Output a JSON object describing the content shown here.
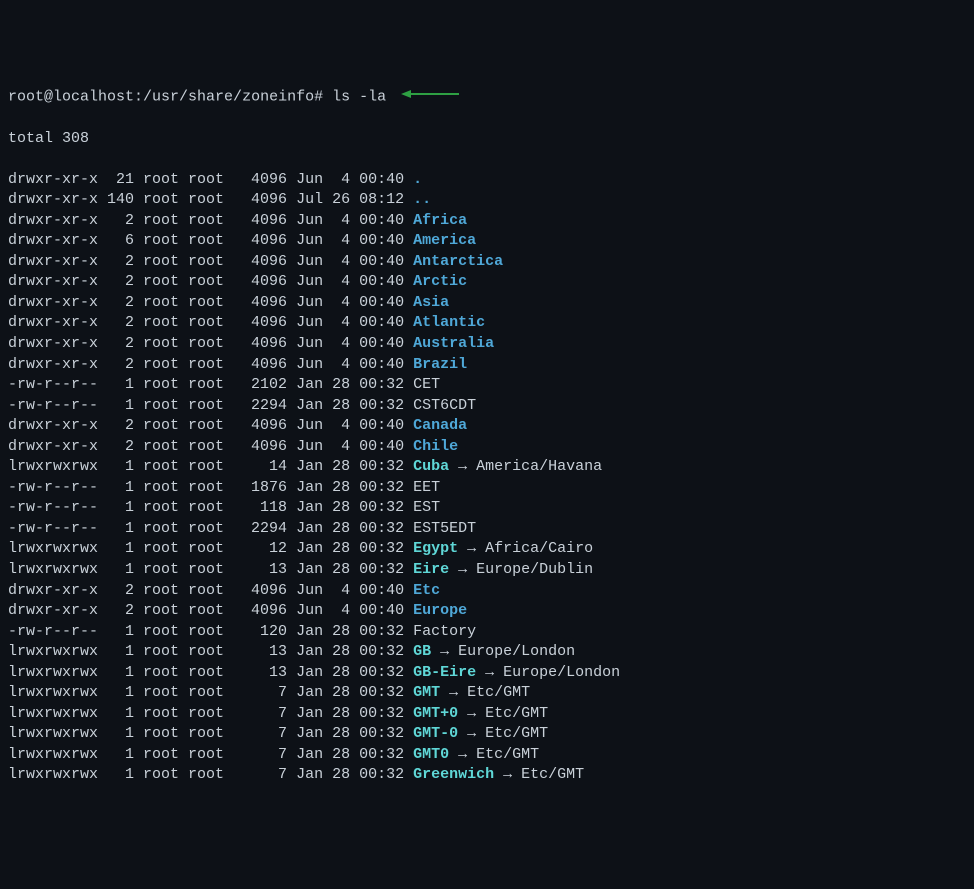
{
  "prompt": {
    "user_host": "root@localhost",
    "path": "/usr/share/zoneinfo",
    "sep": "#",
    "command": "ls -la"
  },
  "total_line": "total 308",
  "entries": [
    {
      "perms": "drwxr-xr-x",
      "links": "21",
      "owner": "root",
      "group": "root",
      "size": "4096",
      "date": "Jun  4 00:40",
      "name": ".",
      "type": "dir"
    },
    {
      "perms": "drwxr-xr-x",
      "links": "140",
      "owner": "root",
      "group": "root",
      "size": "4096",
      "date": "Jul 26 08:12",
      "name": "..",
      "type": "dir"
    },
    {
      "perms": "drwxr-xr-x",
      "links": "2",
      "owner": "root",
      "group": "root",
      "size": "4096",
      "date": "Jun  4 00:40",
      "name": "Africa",
      "type": "dir"
    },
    {
      "perms": "drwxr-xr-x",
      "links": "6",
      "owner": "root",
      "group": "root",
      "size": "4096",
      "date": "Jun  4 00:40",
      "name": "America",
      "type": "dir"
    },
    {
      "perms": "drwxr-xr-x",
      "links": "2",
      "owner": "root",
      "group": "root",
      "size": "4096",
      "date": "Jun  4 00:40",
      "name": "Antarctica",
      "type": "dir"
    },
    {
      "perms": "drwxr-xr-x",
      "links": "2",
      "owner": "root",
      "group": "root",
      "size": "4096",
      "date": "Jun  4 00:40",
      "name": "Arctic",
      "type": "dir"
    },
    {
      "perms": "drwxr-xr-x",
      "links": "2",
      "owner": "root",
      "group": "root",
      "size": "4096",
      "date": "Jun  4 00:40",
      "name": "Asia",
      "type": "dir"
    },
    {
      "perms": "drwxr-xr-x",
      "links": "2",
      "owner": "root",
      "group": "root",
      "size": "4096",
      "date": "Jun  4 00:40",
      "name": "Atlantic",
      "type": "dir"
    },
    {
      "perms": "drwxr-xr-x",
      "links": "2",
      "owner": "root",
      "group": "root",
      "size": "4096",
      "date": "Jun  4 00:40",
      "name": "Australia",
      "type": "dir"
    },
    {
      "perms": "drwxr-xr-x",
      "links": "2",
      "owner": "root",
      "group": "root",
      "size": "4096",
      "date": "Jun  4 00:40",
      "name": "Brazil",
      "type": "dir"
    },
    {
      "perms": "-rw-r--r--",
      "links": "1",
      "owner": "root",
      "group": "root",
      "size": "2102",
      "date": "Jan 28 00:32",
      "name": "CET",
      "type": "file"
    },
    {
      "perms": "-rw-r--r--",
      "links": "1",
      "owner": "root",
      "group": "root",
      "size": "2294",
      "date": "Jan 28 00:32",
      "name": "CST6CDT",
      "type": "file"
    },
    {
      "perms": "drwxr-xr-x",
      "links": "2",
      "owner": "root",
      "group": "root",
      "size": "4096",
      "date": "Jun  4 00:40",
      "name": "Canada",
      "type": "dir"
    },
    {
      "perms": "drwxr-xr-x",
      "links": "2",
      "owner": "root",
      "group": "root",
      "size": "4096",
      "date": "Jun  4 00:40",
      "name": "Chile",
      "type": "dir"
    },
    {
      "perms": "lrwxrwxrwx",
      "links": "1",
      "owner": "root",
      "group": "root",
      "size": "14",
      "date": "Jan 28 00:32",
      "name": "Cuba",
      "type": "link",
      "target": "America/Havana"
    },
    {
      "perms": "-rw-r--r--",
      "links": "1",
      "owner": "root",
      "group": "root",
      "size": "1876",
      "date": "Jan 28 00:32",
      "name": "EET",
      "type": "file"
    },
    {
      "perms": "-rw-r--r--",
      "links": "1",
      "owner": "root",
      "group": "root",
      "size": "118",
      "date": "Jan 28 00:32",
      "name": "EST",
      "type": "file"
    },
    {
      "perms": "-rw-r--r--",
      "links": "1",
      "owner": "root",
      "group": "root",
      "size": "2294",
      "date": "Jan 28 00:32",
      "name": "EST5EDT",
      "type": "file"
    },
    {
      "perms": "lrwxrwxrwx",
      "links": "1",
      "owner": "root",
      "group": "root",
      "size": "12",
      "date": "Jan 28 00:32",
      "name": "Egypt",
      "type": "link",
      "target": "Africa/Cairo"
    },
    {
      "perms": "lrwxrwxrwx",
      "links": "1",
      "owner": "root",
      "group": "root",
      "size": "13",
      "date": "Jan 28 00:32",
      "name": "Eire",
      "type": "link",
      "target": "Europe/Dublin"
    },
    {
      "perms": "drwxr-xr-x",
      "links": "2",
      "owner": "root",
      "group": "root",
      "size": "4096",
      "date": "Jun  4 00:40",
      "name": "Etc",
      "type": "dir"
    },
    {
      "perms": "drwxr-xr-x",
      "links": "2",
      "owner": "root",
      "group": "root",
      "size": "4096",
      "date": "Jun  4 00:40",
      "name": "Europe",
      "type": "dir"
    },
    {
      "perms": "-rw-r--r--",
      "links": "1",
      "owner": "root",
      "group": "root",
      "size": "120",
      "date": "Jan 28 00:32",
      "name": "Factory",
      "type": "file"
    },
    {
      "perms": "lrwxrwxrwx",
      "links": "1",
      "owner": "root",
      "group": "root",
      "size": "13",
      "date": "Jan 28 00:32",
      "name": "GB",
      "type": "link",
      "target": "Europe/London"
    },
    {
      "perms": "lrwxrwxrwx",
      "links": "1",
      "owner": "root",
      "group": "root",
      "size": "13",
      "date": "Jan 28 00:32",
      "name": "GB-Eire",
      "type": "link",
      "target": "Europe/London"
    },
    {
      "perms": "lrwxrwxrwx",
      "links": "1",
      "owner": "root",
      "group": "root",
      "size": "7",
      "date": "Jan 28 00:32",
      "name": "GMT",
      "type": "link",
      "target": "Etc/GMT"
    },
    {
      "perms": "lrwxrwxrwx",
      "links": "1",
      "owner": "root",
      "group": "root",
      "size": "7",
      "date": "Jan 28 00:32",
      "name": "GMT+0",
      "type": "link",
      "target": "Etc/GMT"
    },
    {
      "perms": "lrwxrwxrwx",
      "links": "1",
      "owner": "root",
      "group": "root",
      "size": "7",
      "date": "Jan 28 00:32",
      "name": "GMT-0",
      "type": "link",
      "target": "Etc/GMT"
    },
    {
      "perms": "lrwxrwxrwx",
      "links": "1",
      "owner": "root",
      "group": "root",
      "size": "7",
      "date": "Jan 28 00:32",
      "name": "GMT0",
      "type": "link",
      "target": "Etc/GMT"
    },
    {
      "perms": "lrwxrwxrwx",
      "links": "1",
      "owner": "root",
      "group": "root",
      "size": "7",
      "date": "Jan 28 00:32",
      "name": "Greenwich",
      "type": "link",
      "target": "Etc/GMT"
    }
  ],
  "symlink_arrow": "→"
}
